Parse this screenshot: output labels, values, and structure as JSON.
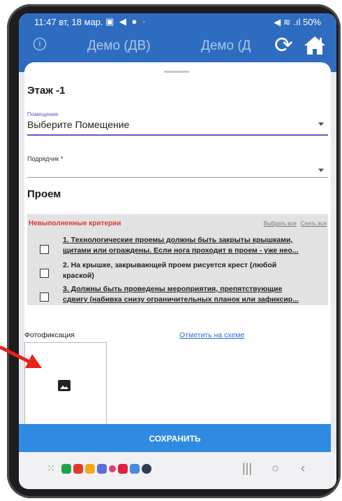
{
  "status": {
    "time": "11:47",
    "date": "вт, 18 мар.",
    "right": "50%"
  },
  "header": {
    "tab1": "Демо (ДВ)",
    "tab2": "Демо (Д"
  },
  "form": {
    "floor": "Этаж -1",
    "room_label": "Помещение",
    "room_value": "Выберите Помещение",
    "contractor_label": "Подрядчик *",
    "opening_title": "Проем"
  },
  "criteria": {
    "title": "Невыполненные критерии",
    "select_all": "Выбрать все",
    "clear_all": "Снять все",
    "items": [
      {
        "line1": "1. Технологические проемы должны быть закрыты крышками,",
        "line2": "щитами или ограждены. Если нога проходит в проем - уже нео..."
      },
      {
        "line1": "2. На крышке, закрывающей проем рисуется крест (любой",
        "line2": "краской)"
      },
      {
        "line1": "3. Должны быть проведены мероприятия, препятствующие",
        "line2": "сдвигу (набивка снизу ограничительных планок или зафиксир..."
      }
    ]
  },
  "photo": {
    "label": "Фотофиксация",
    "scheme_link": "Отметить на схеме"
  },
  "save_label": "СОХРАНИТЬ",
  "colors": {
    "appbar": "#2e6cc0",
    "accent": "#6b58c3",
    "criteria_title": "#d93b33",
    "button": "#2f8ae2",
    "annotation_arrow": "#e8231b"
  },
  "icons": [
    "info-icon",
    "sync-icon",
    "home-icon",
    "image-icon",
    "apps-grid-icon",
    "recents-icon",
    "home-nav-icon",
    "back-icon"
  ]
}
